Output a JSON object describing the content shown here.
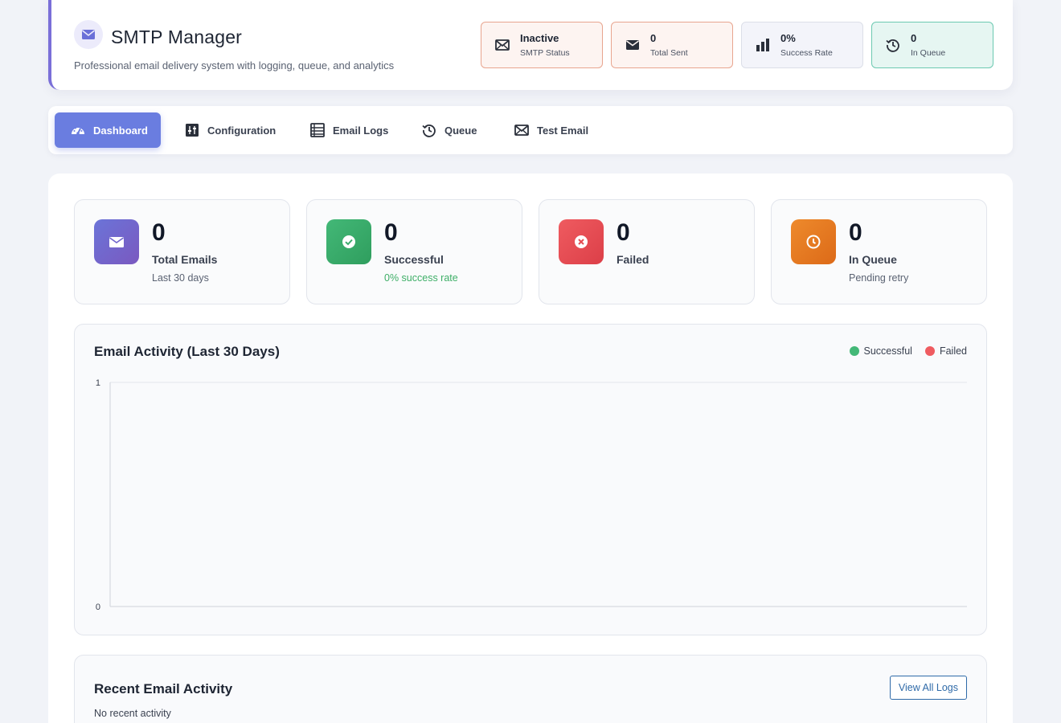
{
  "header": {
    "title": "SMTP Manager",
    "subtitle": "Professional email delivery system with logging, queue, and analytics",
    "logo_icon": "envelope-icon",
    "pills": [
      {
        "value": "Inactive",
        "label": "SMTP Status",
        "icon": "envelope-icon"
      },
      {
        "value": "0",
        "label": "Total Sent",
        "icon": "mail-icon"
      },
      {
        "value": "0%",
        "label": "Success Rate",
        "icon": "bar-chart-icon"
      },
      {
        "value": "0",
        "label": "In Queue",
        "icon": "history-icon"
      }
    ]
  },
  "tabs": [
    {
      "label": "Dashboard",
      "icon": "dashboard-icon",
      "active": true
    },
    {
      "label": "Configuration",
      "icon": "sliders-icon"
    },
    {
      "label": "Email Logs",
      "icon": "list-icon"
    },
    {
      "label": "Queue",
      "icon": "history-icon"
    },
    {
      "label": "Test Email",
      "icon": "envelope-icon"
    }
  ],
  "stats": [
    {
      "value": "0",
      "label": "Total Emails",
      "sub": "Last 30 days",
      "icon": "envelope-icon"
    },
    {
      "value": "0",
      "label": "Successful",
      "sub": "0% success rate",
      "icon": "check-circle-icon"
    },
    {
      "value": "0",
      "label": "Failed",
      "sub": "",
      "icon": "x-circle-icon"
    },
    {
      "value": "0",
      "label": "In Queue",
      "sub": "Pending retry",
      "icon": "clock-icon"
    }
  ],
  "colors": {
    "accent": "#6a7de0",
    "success": "#43b877",
    "failed": "#ef5b60",
    "queue": "#ee8a2c"
  },
  "chart_data": {
    "type": "line",
    "title": "Email Activity (Last 30 Days)",
    "series": [
      {
        "name": "Successful",
        "color": "#43b877",
        "values": []
      },
      {
        "name": "Failed",
        "color": "#ef5b60",
        "values": []
      }
    ],
    "ylim": [
      0,
      1
    ],
    "yticks": [
      "1",
      "0"
    ],
    "legend": "top-right",
    "grid": false
  },
  "recent": {
    "title": "Recent Email Activity",
    "empty_text": "No recent activity",
    "view_all_label": "View All Logs"
  }
}
